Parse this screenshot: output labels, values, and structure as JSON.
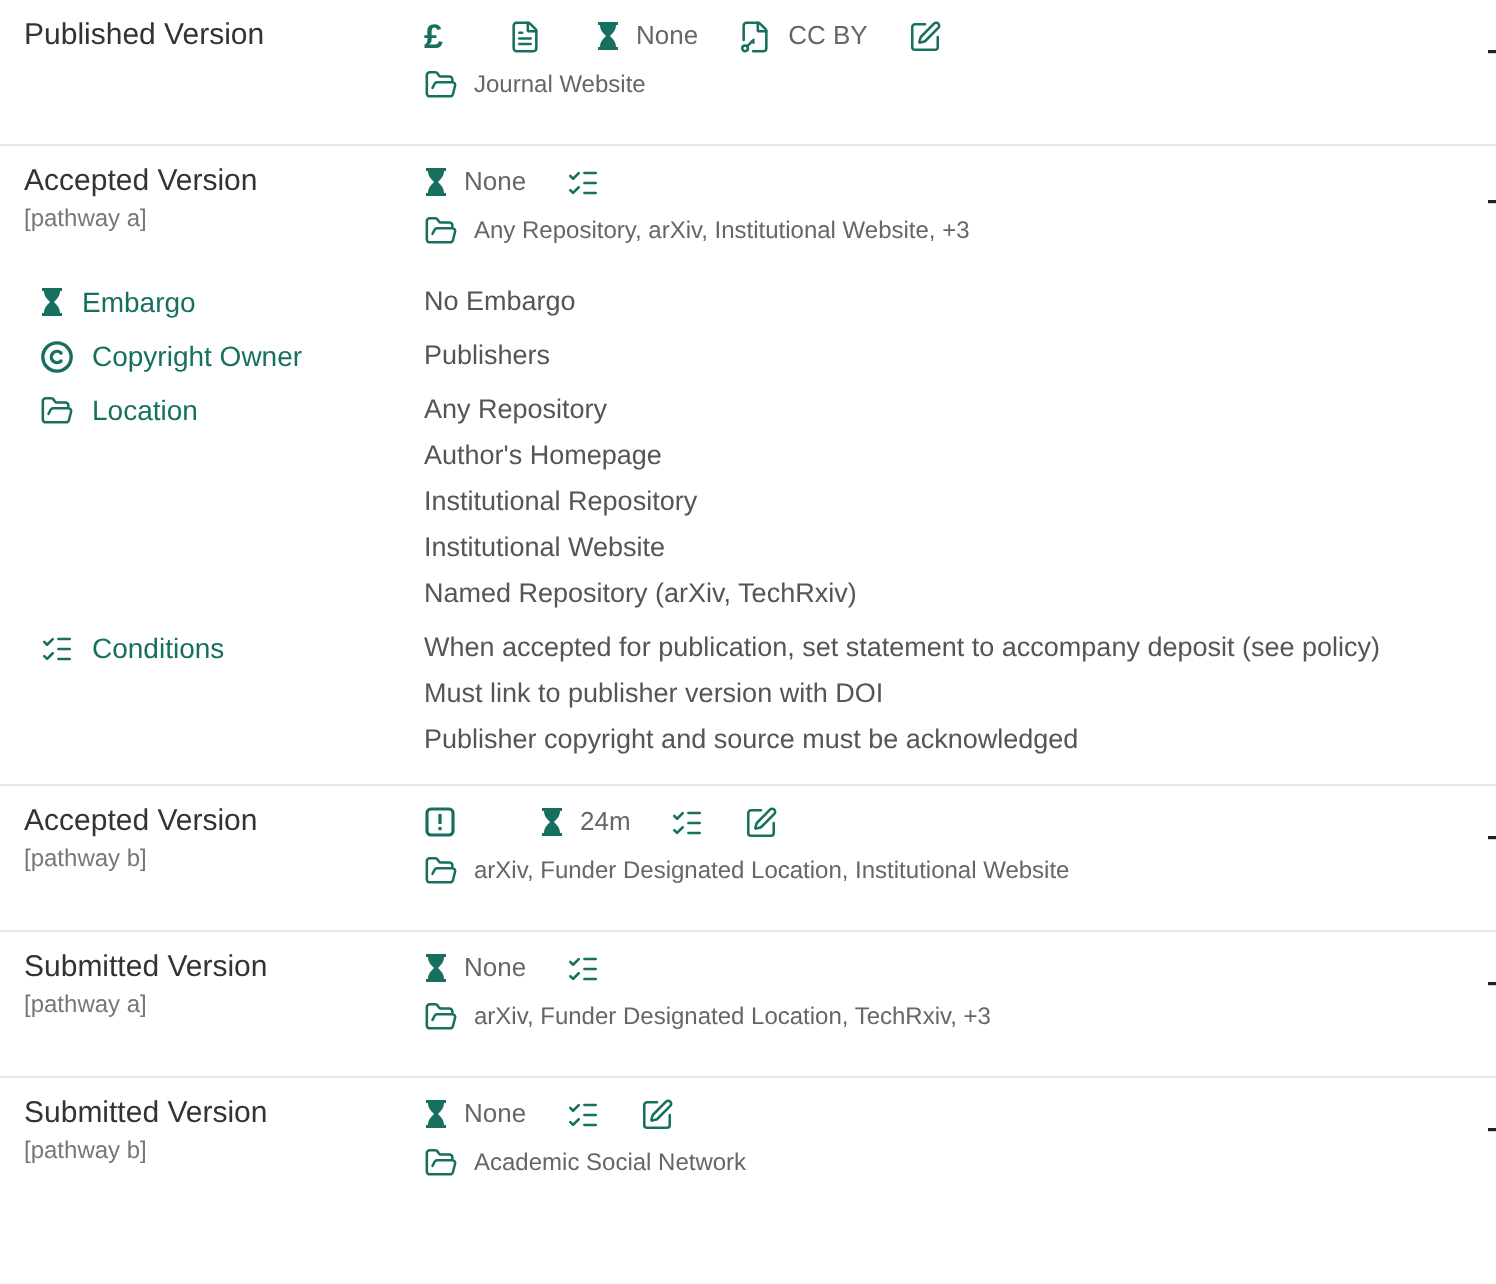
{
  "pathways": [
    {
      "title": "Published Version",
      "expanded": false,
      "badges": [
        {
          "kind": "fee",
          "text": "£"
        },
        {
          "kind": "document"
        },
        {
          "kind": "embargo",
          "text": "None"
        },
        {
          "kind": "license",
          "text": "CC BY"
        },
        {
          "kind": "edit"
        }
      ],
      "locations": "Journal Website"
    },
    {
      "title": "Accepted Version",
      "subtitle": "[pathway a]",
      "expanded": true,
      "badges": [
        {
          "kind": "embargo",
          "text": "None"
        },
        {
          "kind": "conditions"
        }
      ],
      "locations": "Any Repository, arXiv, Institutional Website, +3",
      "details": [
        {
          "kind": "embargo",
          "label": "Embargo",
          "values": [
            "No Embargo"
          ]
        },
        {
          "kind": "copyright",
          "label": "Copyright Owner",
          "values": [
            "Publishers"
          ]
        },
        {
          "kind": "location",
          "label": "Location",
          "values": [
            "Any Repository",
            "Author's Homepage",
            "Institutional Repository",
            "Institutional Website",
            "Named Repository (arXiv, TechRxiv)"
          ]
        },
        {
          "kind": "conditions",
          "label": "Conditions",
          "values": [
            "When accepted for publication, set statement to accompany deposit (see policy)",
            "Must link to publisher version with DOI",
            "Publisher copyright and source must be acknowledged"
          ]
        }
      ]
    },
    {
      "title": "Accepted Version",
      "subtitle": "[pathway b]",
      "expanded": false,
      "badges": [
        {
          "kind": "alert"
        },
        {
          "kind": "embargo",
          "text": "24m"
        },
        {
          "kind": "conditions"
        },
        {
          "kind": "edit"
        }
      ],
      "locations": "arXiv, Funder Designated Location, Institutional Website"
    },
    {
      "title": "Submitted Version",
      "subtitle": "[pathway a]",
      "expanded": false,
      "badges": [
        {
          "kind": "embargo",
          "text": "None"
        },
        {
          "kind": "conditions"
        }
      ],
      "locations": "arXiv, Funder Designated Location, TechRxiv, +3"
    },
    {
      "title": "Submitted Version",
      "subtitle": "[pathway b]",
      "expanded": false,
      "badges": [
        {
          "kind": "embargo",
          "text": "None"
        },
        {
          "kind": "conditions"
        },
        {
          "kind": "edit"
        }
      ],
      "locations": "Academic Social Network"
    }
  ]
}
